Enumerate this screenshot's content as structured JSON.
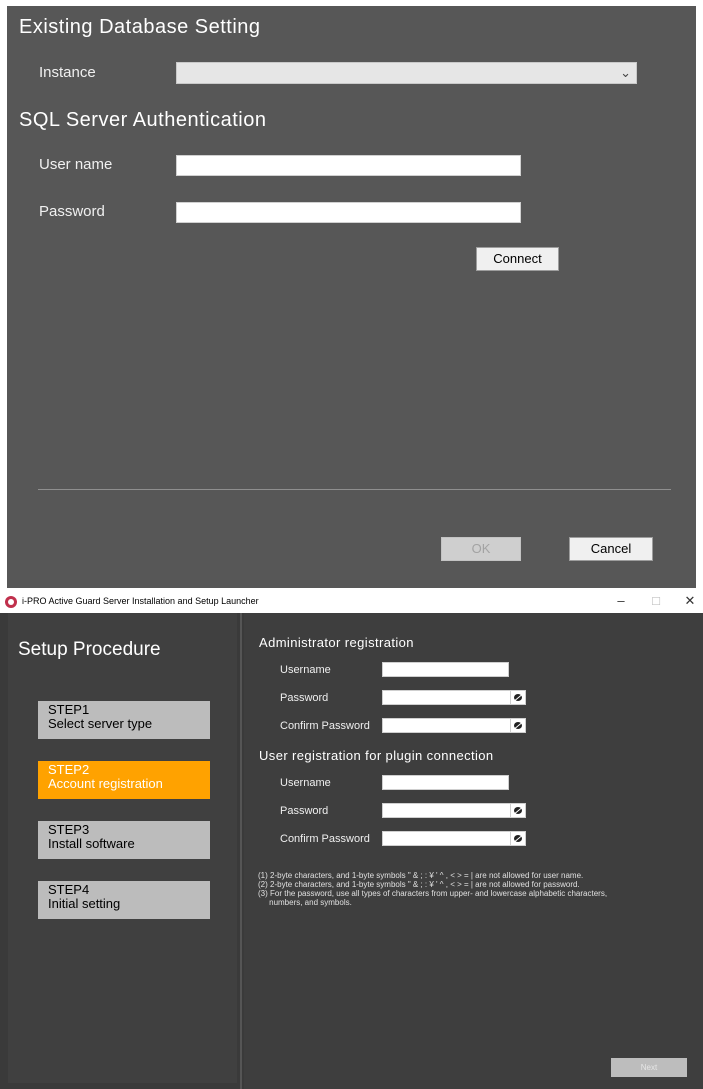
{
  "db_dialog": {
    "title": "Existing Database Setting",
    "instance_label": "Instance",
    "instance_value": "",
    "auth_title": "SQL Server Authentication",
    "user_label": "User name",
    "user_value": "",
    "password_label": "Password",
    "password_value": "",
    "connect_label": "Connect",
    "ok_label": "OK",
    "cancel_label": "Cancel"
  },
  "launcher": {
    "window_title": "i-PRO Active Guard Server Installation and Setup Launcher",
    "controls": {
      "minimize": "–",
      "maximize": "□",
      "close": "✕"
    },
    "setup_title": "Setup Procedure",
    "steps": [
      {
        "number": "STEP1",
        "name": "Select server type",
        "active": false
      },
      {
        "number": "STEP2",
        "name": "Account registration",
        "active": true
      },
      {
        "number": "STEP3",
        "name": "Install software",
        "active": false
      },
      {
        "number": "STEP4",
        "name": "Initial setting",
        "active": false
      }
    ],
    "admin": {
      "heading": "Administrator registration",
      "username_label": "Username",
      "password_label": "Password",
      "confirm_label": "Confirm Password"
    },
    "plugin": {
      "heading": "User registration for plugin connection",
      "username_label": "Username",
      "password_label": "Password",
      "confirm_label": "Confirm Password"
    },
    "notes": [
      "(1) 2-byte characters, and 1-byte symbols \" & ; : ¥ ' ^ , < > = | are not allowed for user name.",
      "(2) 2-byte characters, and 1-byte symbols \" & ; : ¥ ' ^ , < > = | are not allowed for password.",
      "(3) For the password, use all types of characters from upper- and lowercase alphabetic characters,",
      "     numbers, and symbols."
    ],
    "next_label": "Next"
  },
  "colors": {
    "dialog_bg": "#575757",
    "active_step": "#ffa200",
    "inactive_step": "#bcbcbc"
  }
}
